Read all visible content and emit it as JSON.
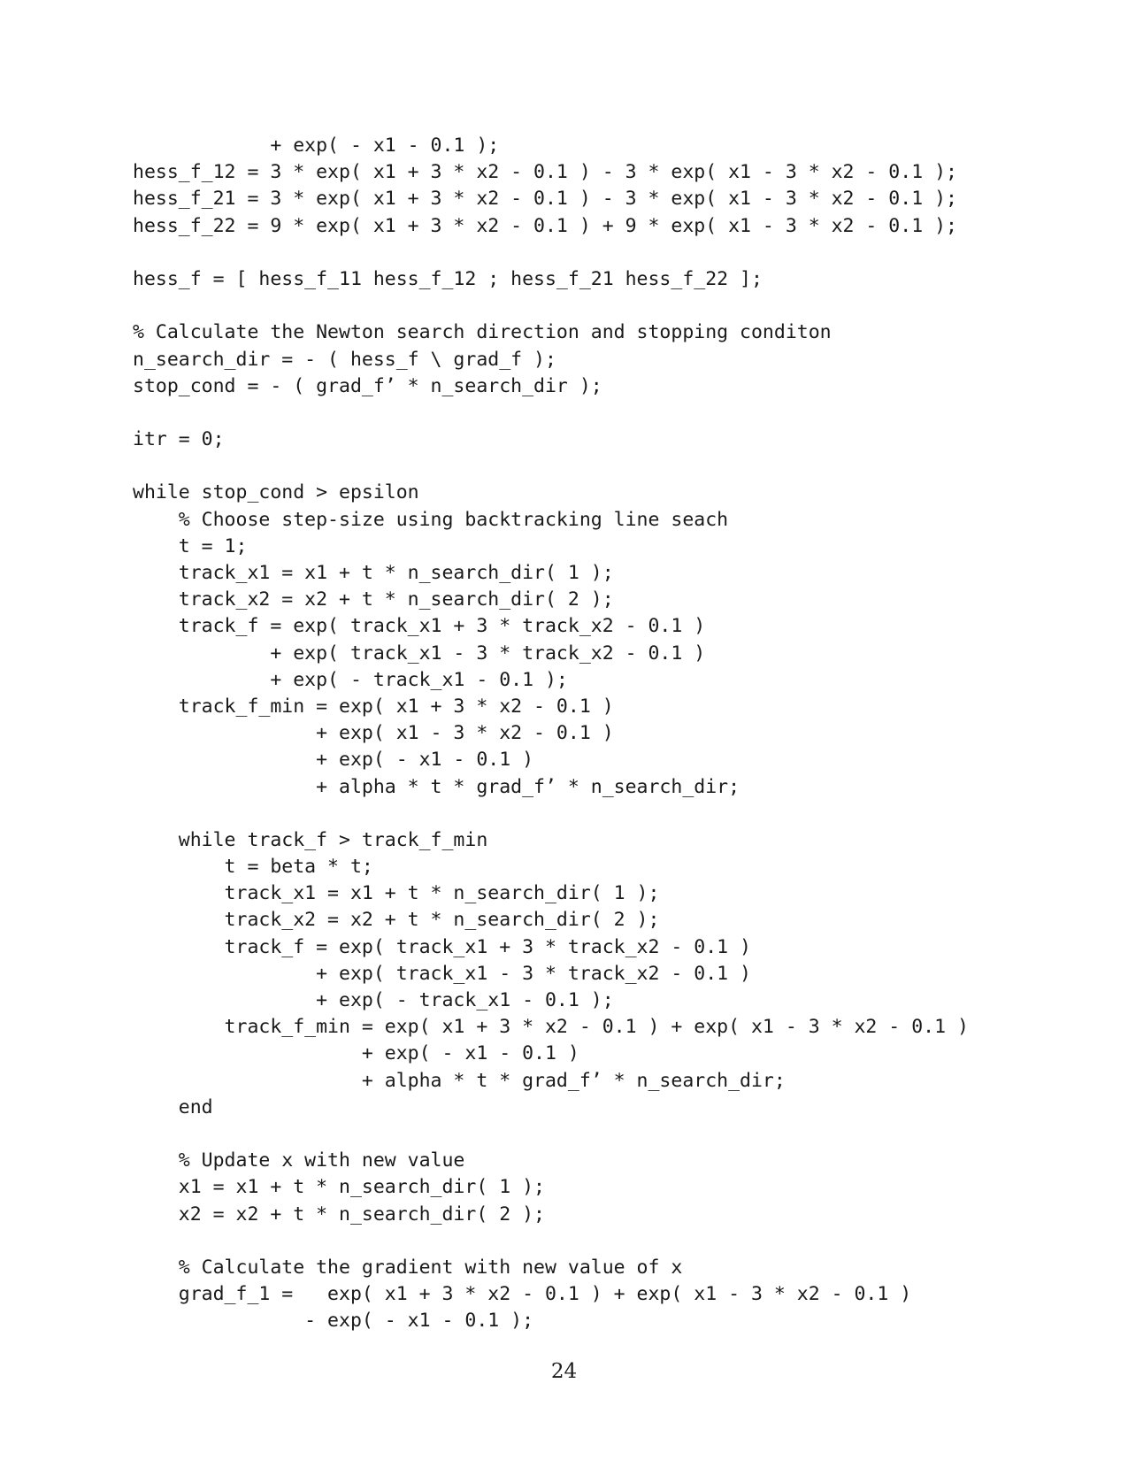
{
  "code_lines": [
    "            + exp( - x1 - 0.1 );",
    "hess_f_12 = 3 * exp( x1 + 3 * x2 - 0.1 ) - 3 * exp( x1 - 3 * x2 - 0.1 );",
    "hess_f_21 = 3 * exp( x1 + 3 * x2 - 0.1 ) - 3 * exp( x1 - 3 * x2 - 0.1 );",
    "hess_f_22 = 9 * exp( x1 + 3 * x2 - 0.1 ) + 9 * exp( x1 - 3 * x2 - 0.1 );",
    "",
    "hess_f = [ hess_f_11 hess_f_12 ; hess_f_21 hess_f_22 ];",
    "",
    "% Calculate the Newton search direction and stopping conditon",
    "n_search_dir = - ( hess_f \\ grad_f );",
    "stop_cond = - ( grad_f’ * n_search_dir );",
    "",
    "itr = 0;",
    "",
    "while stop_cond > epsilon",
    "    % Choose step-size using backtracking line seach",
    "    t = 1;",
    "    track_x1 = x1 + t * n_search_dir( 1 );",
    "    track_x2 = x2 + t * n_search_dir( 2 );",
    "    track_f = exp( track_x1 + 3 * track_x2 - 0.1 )",
    "            + exp( track_x1 - 3 * track_x2 - 0.1 )",
    "            + exp( - track_x1 - 0.1 );",
    "    track_f_min = exp( x1 + 3 * x2 - 0.1 )",
    "                + exp( x1 - 3 * x2 - 0.1 )",
    "                + exp( - x1 - 0.1 )",
    "                + alpha * t * grad_f’ * n_search_dir;",
    "",
    "    while track_f > track_f_min",
    "        t = beta * t;",
    "        track_x1 = x1 + t * n_search_dir( 1 );",
    "        track_x2 = x2 + t * n_search_dir( 2 );",
    "        track_f = exp( track_x1 + 3 * track_x2 - 0.1 )",
    "                + exp( track_x1 - 3 * track_x2 - 0.1 )",
    "                + exp( - track_x1 - 0.1 );",
    "        track_f_min = exp( x1 + 3 * x2 - 0.1 ) + exp( x1 - 3 * x2 - 0.1 )",
    "                    + exp( - x1 - 0.1 )",
    "                    + alpha * t * grad_f’ * n_search_dir;",
    "    end",
    "",
    "    % Update x with new value",
    "    x1 = x1 + t * n_search_dir( 1 );",
    "    x2 = x2 + t * n_search_dir( 2 );",
    "",
    "    % Calculate the gradient with new value of x",
    "    grad_f_1 =   exp( x1 + 3 * x2 - 0.1 ) + exp( x1 - 3 * x2 - 0.1 )",
    "               - exp( - x1 - 0.1 );"
  ],
  "page_number": "24"
}
